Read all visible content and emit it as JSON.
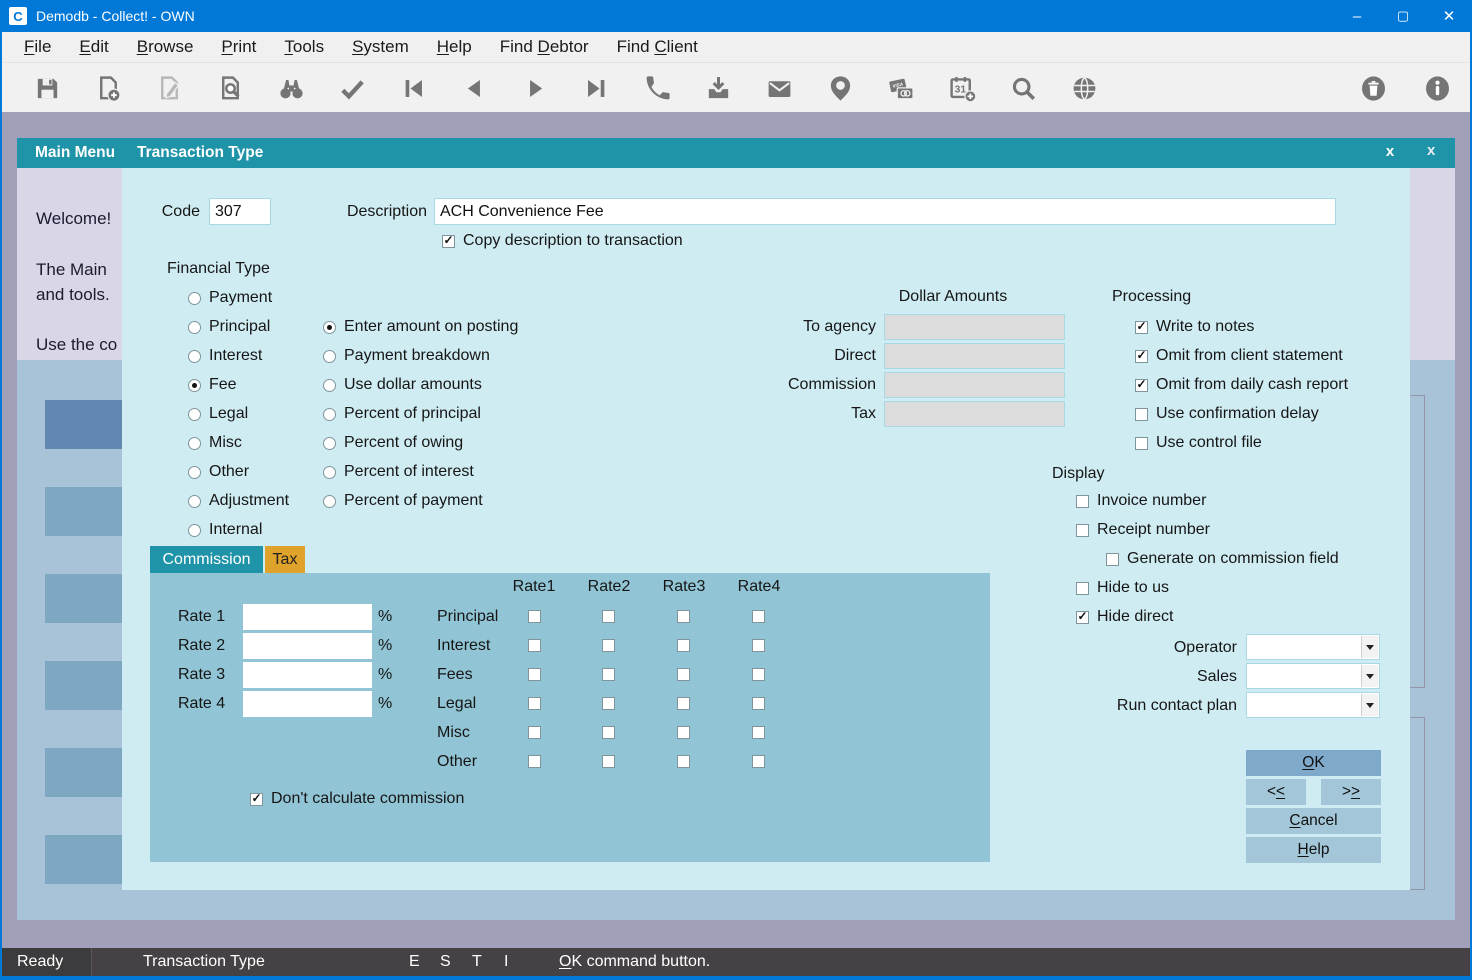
{
  "titlebar": {
    "app_initial": "C",
    "title": "Demodb - Collect! - OWN",
    "minimize": "–",
    "maximize": "▢",
    "close": "✕"
  },
  "menubar": {
    "items": [
      {
        "pre": "",
        "key": "F",
        "post": "ile"
      },
      {
        "pre": "",
        "key": "E",
        "post": "dit"
      },
      {
        "pre": "",
        "key": "B",
        "post": "rowse"
      },
      {
        "pre": "",
        "key": "P",
        "post": "rint"
      },
      {
        "pre": "",
        "key": "T",
        "post": "ools"
      },
      {
        "pre": "",
        "key": "S",
        "post": "ystem"
      },
      {
        "pre": "",
        "key": "H",
        "post": "elp"
      },
      {
        "pre": "Find ",
        "key": "D",
        "post": "ebtor"
      },
      {
        "pre": "Find ",
        "key": "C",
        "post": "lient"
      }
    ]
  },
  "toolbar": {
    "icons": [
      "save",
      "new-record",
      "edit-record",
      "preview",
      "binoculars",
      "checkmark",
      "first-record",
      "previous-record",
      "next-record",
      "last-record",
      "phone",
      "printer",
      "email",
      "balloon",
      "credit-card",
      "calendar-add",
      "search",
      "globe"
    ],
    "right_icons": [
      "trash",
      "info"
    ]
  },
  "main_menu": {
    "title": "Main Menu",
    "close": "x",
    "welcome_lines": [
      "Welcome!",
      "The Main",
      "and tools.",
      "Use the co"
    ]
  },
  "dialog": {
    "title": "Transaction Type",
    "close": "x",
    "code": {
      "label": "Code",
      "value": "307"
    },
    "description": {
      "label": "Description",
      "value": "ACH Convenience Fee"
    },
    "copy_description": {
      "label": "Copy description to transaction",
      "checked": true
    },
    "financial_type": {
      "label": "Financial Type",
      "options": [
        {
          "label": "Payment",
          "selected": false
        },
        {
          "label": "Principal",
          "selected": false
        },
        {
          "label": "Interest",
          "selected": false
        },
        {
          "label": "Fee",
          "selected": true
        },
        {
          "label": "Legal",
          "selected": false
        },
        {
          "label": "Misc",
          "selected": false
        },
        {
          "label": "Other",
          "selected": false
        },
        {
          "label": "Adjustment",
          "selected": false
        },
        {
          "label": "Internal",
          "selected": false
        }
      ]
    },
    "amount_method": {
      "options": [
        {
          "label": "Enter amount on posting",
          "selected": true
        },
        {
          "label": "Payment breakdown",
          "selected": false
        },
        {
          "label": "Use dollar amounts",
          "selected": false
        },
        {
          "label": "Percent of principal",
          "selected": false
        },
        {
          "label": "Percent of owing",
          "selected": false
        },
        {
          "label": "Percent of interest",
          "selected": false
        },
        {
          "label": "Percent of payment",
          "selected": false
        }
      ]
    },
    "dollar_amounts": {
      "label": "Dollar Amounts",
      "fields": [
        {
          "label": "To agency",
          "value": ""
        },
        {
          "label": "Direct",
          "value": ""
        },
        {
          "label": "Commission",
          "value": ""
        },
        {
          "label": "Tax",
          "value": ""
        }
      ]
    },
    "processing": {
      "label": "Processing",
      "items": [
        {
          "label": "Write to notes",
          "checked": true
        },
        {
          "label": "Omit from client statement",
          "checked": true
        },
        {
          "label": "Omit from daily cash report",
          "checked": true
        },
        {
          "label": "Use confirmation delay",
          "checked": false
        },
        {
          "label": "Use control file",
          "checked": false
        }
      ]
    },
    "display": {
      "label": "Display",
      "items": [
        {
          "label": "Invoice number",
          "checked": false
        },
        {
          "label": "Receipt number",
          "checked": false
        },
        {
          "label": "Generate on commission field",
          "checked": false
        },
        {
          "label": "Hide to us",
          "checked": false
        },
        {
          "label": "Hide direct",
          "checked": true
        }
      ]
    },
    "dropdowns": [
      {
        "label": "Operator",
        "value": ""
      },
      {
        "label": "Sales",
        "value": ""
      },
      {
        "label": "Run contact plan",
        "value": ""
      }
    ],
    "tabs": [
      {
        "label": "Commission",
        "active": true
      },
      {
        "label": "Tax",
        "active": false
      }
    ],
    "commission": {
      "rate_headers": [
        "Rate1",
        "Rate2",
        "Rate3",
        "Rate4"
      ],
      "rates": [
        {
          "label": "Rate 1",
          "value": "",
          "suffix": "%"
        },
        {
          "label": "Rate 2",
          "value": "",
          "suffix": "%"
        },
        {
          "label": "Rate 3",
          "value": "",
          "suffix": "%"
        },
        {
          "label": "Rate 4",
          "value": "",
          "suffix": "%"
        }
      ],
      "grid_rows": [
        {
          "label": "Principal",
          "checks": [
            false,
            false,
            false,
            false
          ]
        },
        {
          "label": "Interest",
          "checks": [
            false,
            false,
            false,
            false
          ]
        },
        {
          "label": "Fees",
          "checks": [
            false,
            false,
            false,
            false
          ]
        },
        {
          "label": "Legal",
          "checks": [
            false,
            false,
            false,
            false
          ]
        },
        {
          "label": "Misc",
          "checks": [
            false,
            false,
            false,
            false
          ]
        },
        {
          "label": "Other",
          "checks": [
            false,
            false,
            false,
            false
          ]
        }
      ],
      "dont_calculate": {
        "label": "Don't calculate commission",
        "checked": true
      }
    },
    "buttons": {
      "ok": {
        "pre": "",
        "key": "O",
        "post": "K"
      },
      "prev": {
        "pre": "<",
        "key": "<",
        "post": ""
      },
      "next": {
        "pre": ">",
        "key": ">",
        "post": ""
      },
      "cancel": {
        "pre": "",
        "key": "C",
        "post": "ancel"
      },
      "help": {
        "pre": "",
        "key": "H",
        "post": "elp"
      }
    }
  },
  "statusbar": {
    "ready": "Ready",
    "context": "Transaction Type",
    "flags": [
      "E",
      "S",
      "T",
      "I"
    ],
    "hint": {
      "pre": "",
      "key": "O",
      "post": "K command button."
    }
  }
}
